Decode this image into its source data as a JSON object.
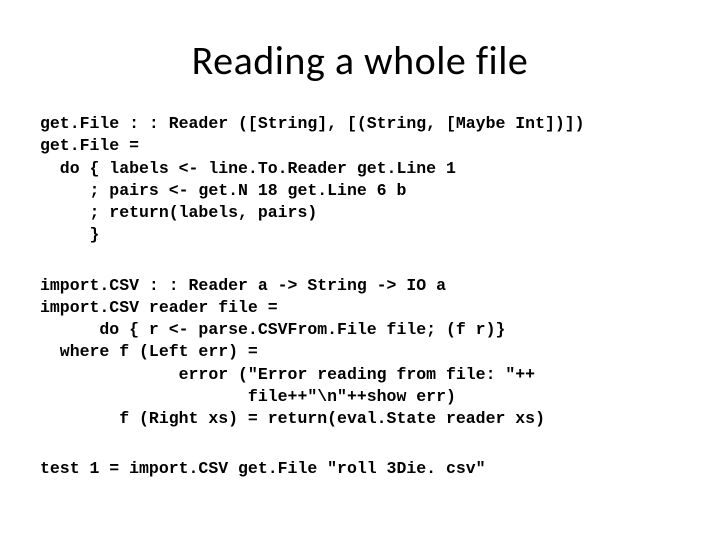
{
  "title": "Reading a whole file",
  "code_block_1": "get.File : : Reader ([String], [(String, [Maybe Int])])\nget.File =\n  do { labels <- line.To.Reader get.Line 1\n     ; pairs <- get.N 18 get.Line 6 b\n     ; return(labels, pairs)\n     }",
  "code_block_2": "import.CSV : : Reader a -> String -> IO a\nimport.CSV reader file =\n      do { r <- parse.CSVFrom.File file; (f r)}\n  where f (Left err) =\n              error (\"Error reading from file: \"++\n                     file++\"\\n\"++show err)\n        f (Right xs) = return(eval.State reader xs)",
  "code_block_3": "test 1 = import.CSV get.File \"roll 3Die. csv\""
}
